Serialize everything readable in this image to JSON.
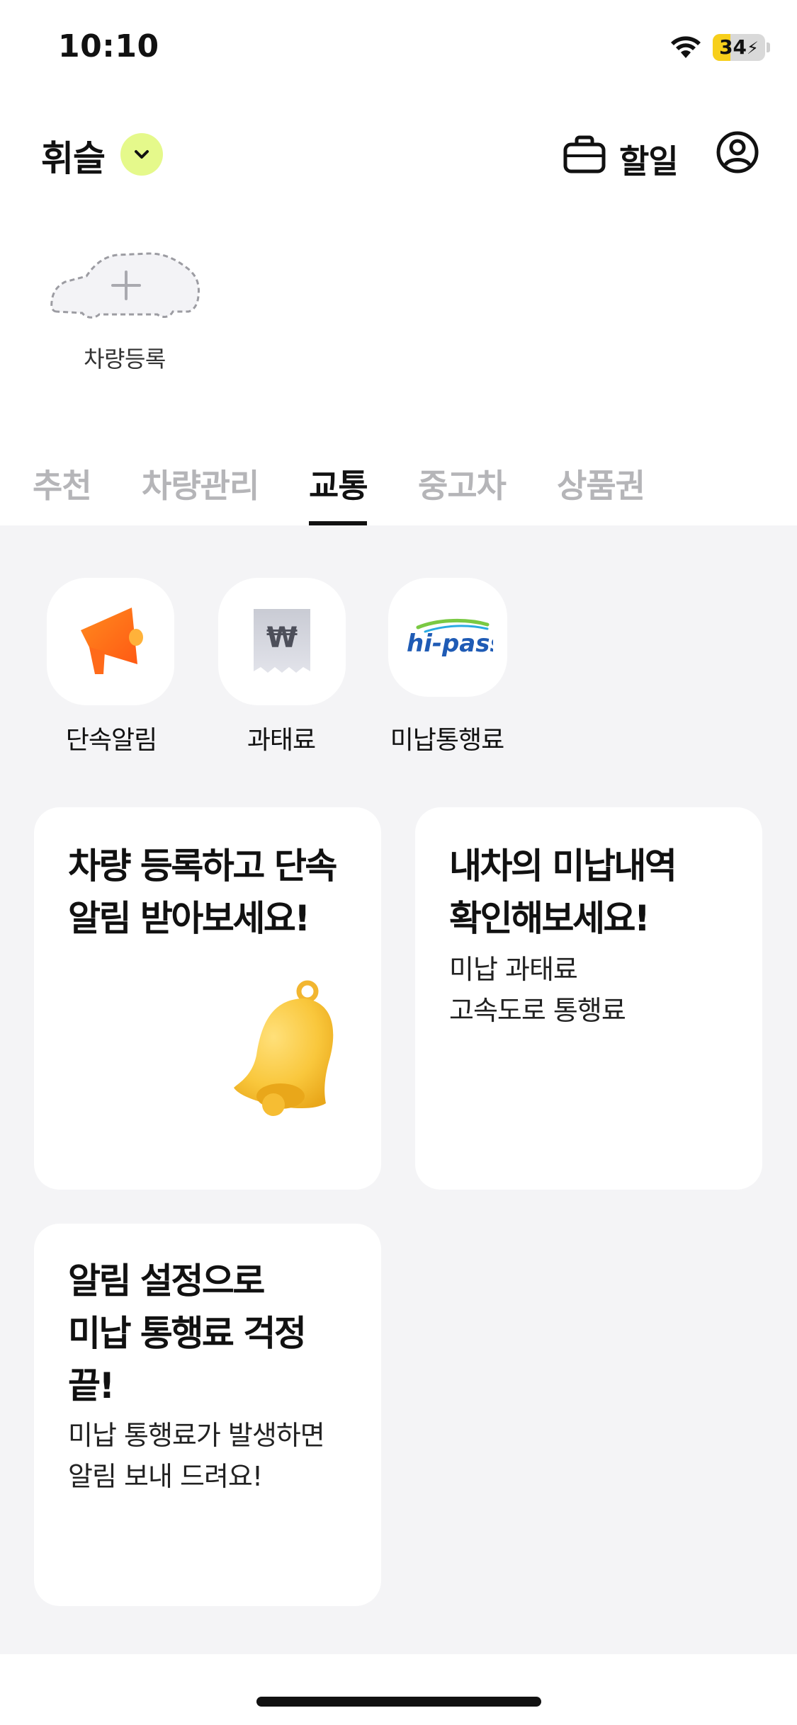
{
  "status_bar": {
    "time": "10:10",
    "battery_level": "34",
    "battery_percent": 34
  },
  "header": {
    "user_name": "휘슬",
    "todo_label": "할일"
  },
  "vehicle": {
    "register_label": "차량등록"
  },
  "tabs": [
    {
      "label": "추천",
      "active": false
    },
    {
      "label": "차량관리",
      "active": false
    },
    {
      "label": "교통",
      "active": true
    },
    {
      "label": "중고차",
      "active": false
    },
    {
      "label": "상품권",
      "active": false
    }
  ],
  "services": [
    {
      "label": "단속알림",
      "icon": "megaphone-icon"
    },
    {
      "label": "과태료",
      "icon": "won-receipt-icon"
    },
    {
      "label": "미납통행료",
      "icon": "hipass-logo-icon",
      "logo_text": "hi-pass"
    }
  ],
  "cards": {
    "enforcement": {
      "title": "차량 등록하고 단속\n알림 받아보세요!",
      "icon": "bell-icon"
    },
    "unpaid": {
      "title": "내차의 미납내역\n확인해보세요!",
      "desc": "미납 과태료\n고속도로 통행료"
    },
    "notify": {
      "title": "알림 설정으로\n미납 통행료 걱정\n끝!",
      "desc": "미납 통행료가 발생하면\n알림 보내 드려요!"
    }
  },
  "colors": {
    "accent_lime": "#e5f98b",
    "background_gray": "#f4f4f6",
    "battery_yellow": "#f7cf1b",
    "megaphone_orange": "#ff6a1a",
    "bell_yellow": "#f9c73c",
    "hipass_blue": "#1f5bb5",
    "tab_inactive": "#b5b5b8"
  }
}
